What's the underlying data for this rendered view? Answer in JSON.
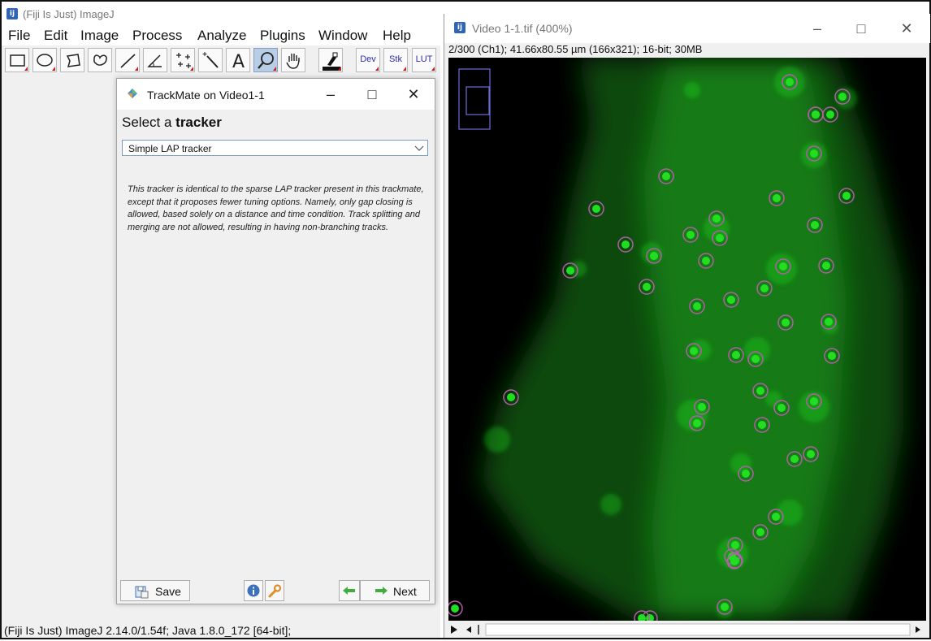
{
  "imagej": {
    "title": "(Fiji Is Just) ImageJ",
    "app_icon_text": "ij",
    "menus": [
      "File",
      "Edit",
      "Image",
      "Process",
      "Analyze",
      "Plugins",
      "Window",
      "Help"
    ],
    "toolbar": {
      "tools": [
        "rectangle-tool-icon",
        "oval-tool-icon",
        "polygon-tool-icon",
        "freehand-tool-icon",
        "line-tool-icon",
        "angle-tool-icon",
        "multipoint-tool-icon",
        "wand-tool-icon",
        "text-tool-icon",
        "magnifier-tool-icon",
        "hand-tool-icon",
        "color-picker-icon"
      ],
      "selected_tool": "magnifier-tool-icon",
      "dev_label": "Dev",
      "stk_label": "Stk",
      "lut_label": "LUT"
    },
    "status": "(Fiji Is Just) ImageJ 2.14.0/1.54f; Java 1.8.0_172 [64-bit];"
  },
  "trackmate": {
    "title": "TrackMate on Video1-1",
    "heading_prefix": "Select a ",
    "heading_bold": "tracker",
    "tracker_selected": "Simple LAP tracker",
    "description": "This tracker is identical to the sparse LAP tracker present in this trackmate, except that it proposes fewer tuning options. Namely, only gap closing is allowed, based solely on a distance and time condition. Track splitting and merging are not allowed, resulting in having non-branching tracks.",
    "save_label": "Save",
    "next_label": "Next"
  },
  "video": {
    "title": "Video 1-1.tif (400%)",
    "info": "2/300 (Ch1); 41.66x80.55 µm (166x321); 16-bit; 30MB"
  },
  "colors": {
    "spot_marker": "#b05fa8",
    "fluorescence": "#22dd22",
    "navigator": "#6f6fd8"
  }
}
